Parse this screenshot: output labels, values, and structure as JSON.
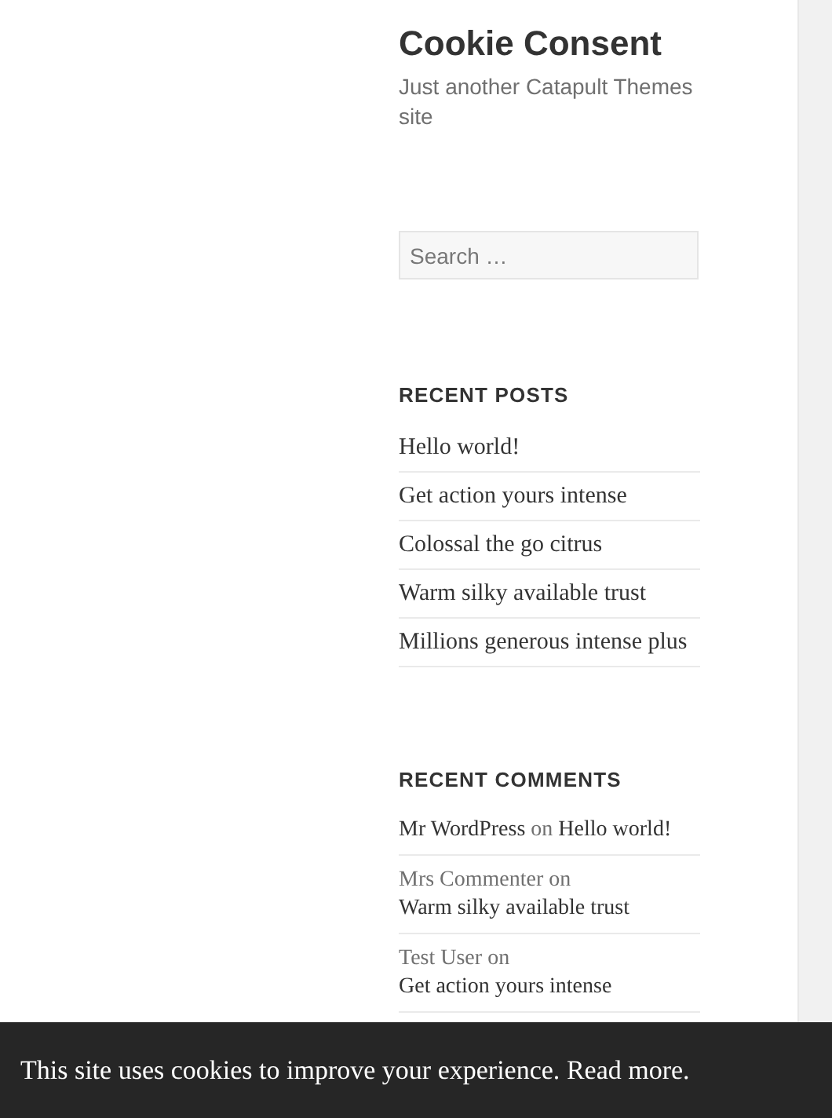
{
  "site": {
    "title": "Cookie Consent",
    "tagline": "Just another Catapult Themes site"
  },
  "search": {
    "placeholder": "Search …"
  },
  "recent_posts": {
    "heading": "RECENT POSTS",
    "items": [
      {
        "label": "Hello world!"
      },
      {
        "label": "Get action yours intense"
      },
      {
        "label": "Colossal the go citrus"
      },
      {
        "label": "Warm silky available trust"
      },
      {
        "label": "Millions generous intense plus"
      }
    ]
  },
  "recent_comments": {
    "heading": "RECENT COMMENTS",
    "items": [
      {
        "author": "Mr WordPress",
        "author_linked": true,
        "joiner": "on",
        "post": "Hello world!"
      },
      {
        "author": "Mrs Commenter",
        "author_linked": false,
        "joiner": "on",
        "post": "Warm silky available trust"
      },
      {
        "author": "Test User",
        "author_linked": false,
        "joiner": "on",
        "post": "Get action yours intense"
      }
    ]
  },
  "cookie_bar": {
    "message": "This site uses cookies to improve your experience.",
    "link": "Read more."
  }
}
